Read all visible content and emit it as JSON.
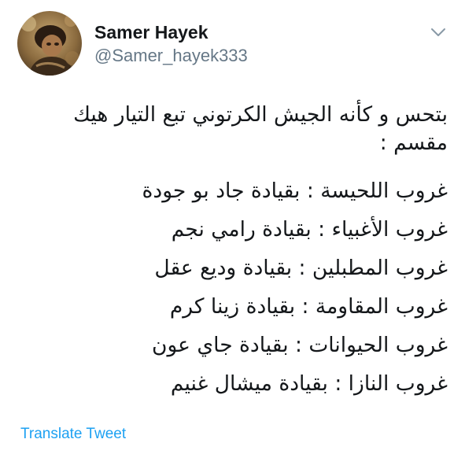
{
  "author": {
    "display_name": "Samer Hayek",
    "handle": "@Samer_hayek333"
  },
  "tweet": {
    "intro_lines": [
      "بتحس و كأنه الجيش الكرتوني تبع التيار هيك",
      "مقسم :"
    ],
    "groups": [
      "غروب اللحيسة : بقيادة جاد بو جودة",
      "غروب الأغبياء : بقيادة رامي نجم",
      "غروب المطبلين : بقيادة وديع عقل",
      "غروب المقاومة : بقيادة زينا كرم",
      "غروب الحيوانات : بقيادة جاي عون",
      "غروب النازا : بقيادة ميشال غنيم"
    ]
  },
  "actions": {
    "translate_label": "Translate Tweet"
  },
  "icons": {
    "avatar": "avatar-photo",
    "menu": "chevron-down-icon"
  },
  "colors": {
    "text": "#14171a",
    "secondary": "#657786",
    "link": "#1da1f2"
  }
}
